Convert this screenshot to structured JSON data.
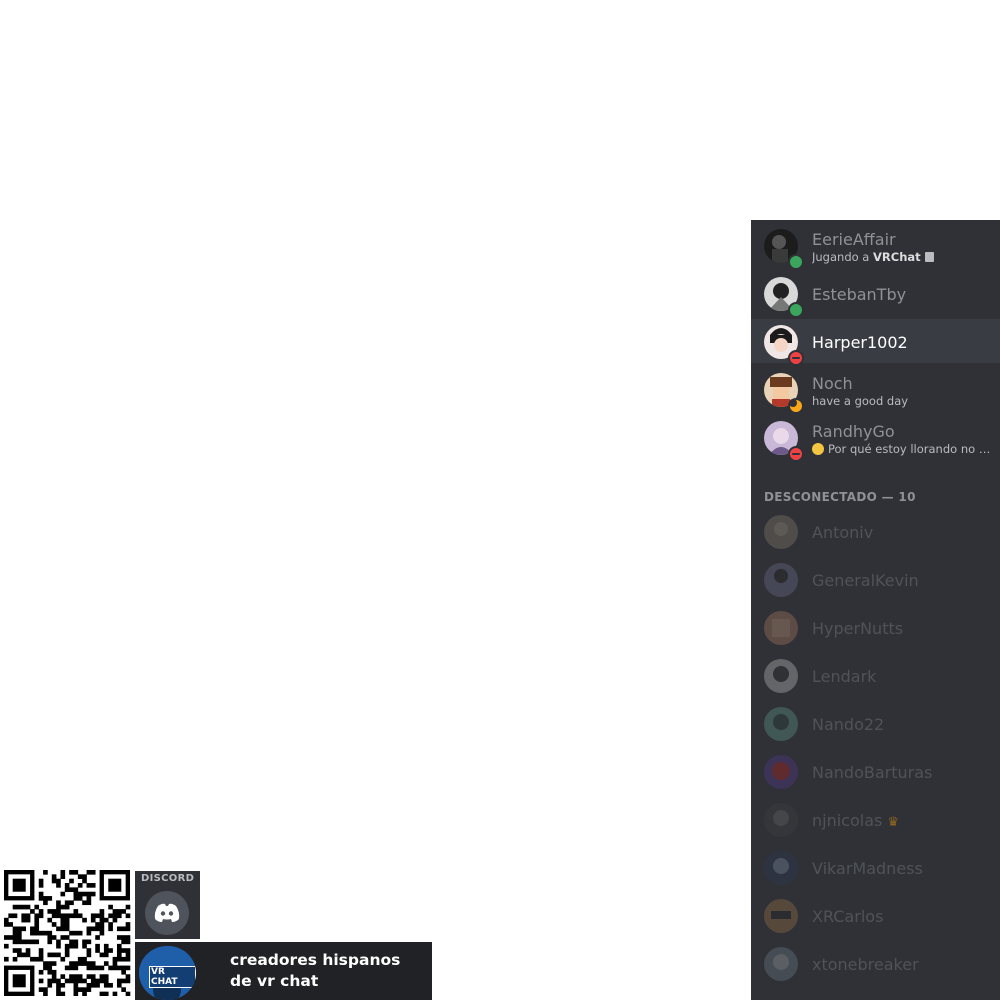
{
  "members": {
    "online": [
      {
        "name": "EerieAffair",
        "status": "online",
        "activity_prefix": "Jugando a ",
        "activity_game": "VRChat",
        "activity_icon": "rich-presence-icon"
      },
      {
        "name": "EstebanTby",
        "status": "online"
      },
      {
        "name": "Harper1002",
        "status": "dnd",
        "highlighted": true
      },
      {
        "name": "Noch",
        "status": "idle",
        "custom_status": "have a good day"
      },
      {
        "name": "RandhyGo",
        "status": "dnd",
        "custom_status": "Por qué estoy llorando no e...",
        "custom_status_emoji": "pensive-emoji"
      }
    ],
    "offline_header": "DESCONECTADO — 10",
    "offline": [
      {
        "name": "Antoniv"
      },
      {
        "name": "GeneralKevin"
      },
      {
        "name": "HyperNutts"
      },
      {
        "name": "Lendark"
      },
      {
        "name": "Nando22"
      },
      {
        "name": "NandoBarturas"
      },
      {
        "name": "njnicolas",
        "badge": "crown-icon"
      },
      {
        "name": "VikarMadness"
      },
      {
        "name": "XRCarlos"
      },
      {
        "name": "xtonebreaker"
      }
    ]
  },
  "widget": {
    "discord_label": "DISCORD",
    "server_icon_text": "VR CHAT",
    "server_name": "creadores hispanos de vr chat"
  },
  "colors": {
    "panel_bg": "#2f3136",
    "online": "#3ba55d",
    "dnd": "#ed4245",
    "idle": "#faa81a"
  }
}
